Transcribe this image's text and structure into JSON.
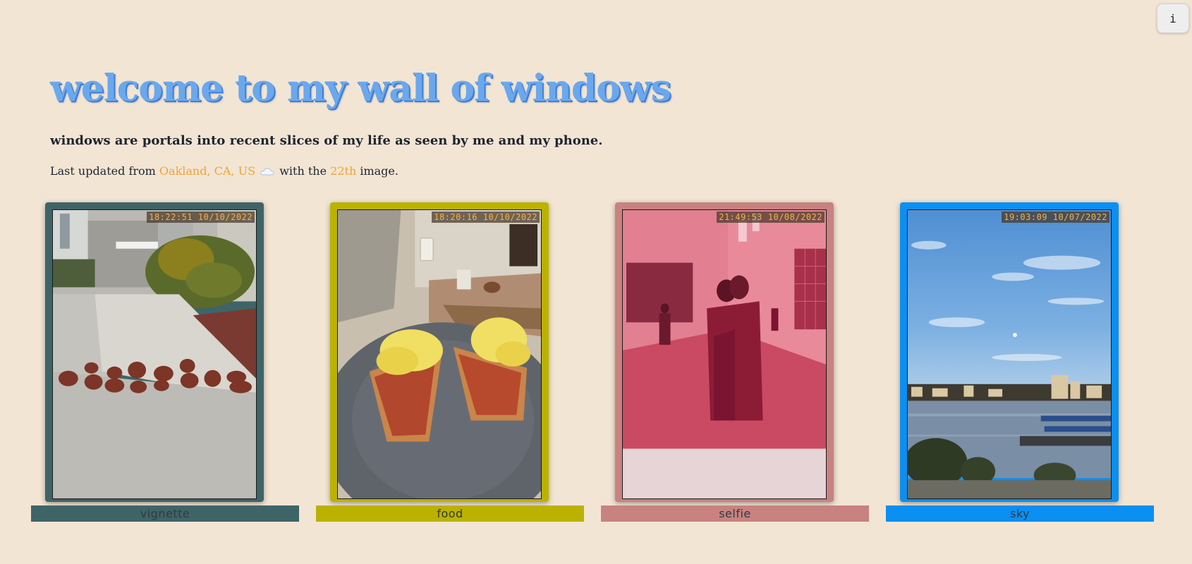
{
  "info_button": {
    "label": "i"
  },
  "header": {
    "title": "welcome to my wall of windows",
    "subtitle": "windows are portals into recent slices of my life as seen by me and my phone.",
    "update": {
      "prefix": "Last updated from ",
      "location": "Oakland, CA, US",
      "weather_icon": "cloud-icon",
      "middle": " with the ",
      "count": "22th",
      "suffix": " image."
    }
  },
  "colors": {
    "background": "#f3e5d3",
    "title": "#6aa8ee",
    "highlight": "#e8a63c",
    "stamp_text": "#f2b34a"
  },
  "windows": [
    {
      "timestamp": "18:22:51 10/10/2022",
      "label": "vignette",
      "color": "#3f6468"
    },
    {
      "timestamp": "18:20:16 10/10/2022",
      "label": "food",
      "color": "#bbb200"
    },
    {
      "timestamp": "21:49:53 10/08/2022",
      "label": "selfie",
      "color": "#c88280"
    },
    {
      "timestamp": "19:03:09 10/07/2022",
      "label": "sky",
      "color": "#0a8ff2"
    }
  ]
}
